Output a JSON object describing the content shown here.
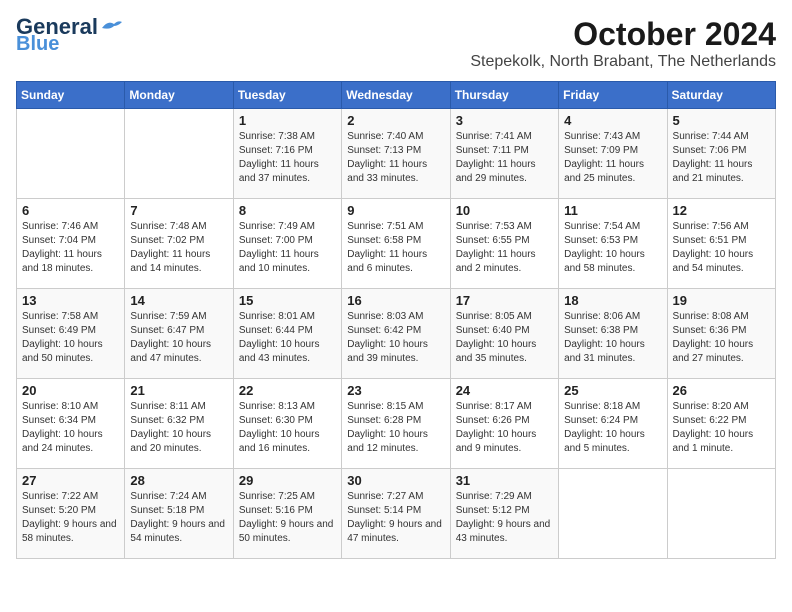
{
  "header": {
    "logo_line1": "General",
    "logo_line2": "Blue",
    "month": "October 2024",
    "location": "Stepekolk, North Brabant, The Netherlands"
  },
  "weekdays": [
    "Sunday",
    "Monday",
    "Tuesday",
    "Wednesday",
    "Thursday",
    "Friday",
    "Saturday"
  ],
  "weeks": [
    [
      {
        "day": "",
        "info": ""
      },
      {
        "day": "",
        "info": ""
      },
      {
        "day": "1",
        "info": "Sunrise: 7:38 AM\nSunset: 7:16 PM\nDaylight: 11 hours and 37 minutes."
      },
      {
        "day": "2",
        "info": "Sunrise: 7:40 AM\nSunset: 7:13 PM\nDaylight: 11 hours and 33 minutes."
      },
      {
        "day": "3",
        "info": "Sunrise: 7:41 AM\nSunset: 7:11 PM\nDaylight: 11 hours and 29 minutes."
      },
      {
        "day": "4",
        "info": "Sunrise: 7:43 AM\nSunset: 7:09 PM\nDaylight: 11 hours and 25 minutes."
      },
      {
        "day": "5",
        "info": "Sunrise: 7:44 AM\nSunset: 7:06 PM\nDaylight: 11 hours and 21 minutes."
      }
    ],
    [
      {
        "day": "6",
        "info": "Sunrise: 7:46 AM\nSunset: 7:04 PM\nDaylight: 11 hours and 18 minutes."
      },
      {
        "day": "7",
        "info": "Sunrise: 7:48 AM\nSunset: 7:02 PM\nDaylight: 11 hours and 14 minutes."
      },
      {
        "day": "8",
        "info": "Sunrise: 7:49 AM\nSunset: 7:00 PM\nDaylight: 11 hours and 10 minutes."
      },
      {
        "day": "9",
        "info": "Sunrise: 7:51 AM\nSunset: 6:58 PM\nDaylight: 11 hours and 6 minutes."
      },
      {
        "day": "10",
        "info": "Sunrise: 7:53 AM\nSunset: 6:55 PM\nDaylight: 11 hours and 2 minutes."
      },
      {
        "day": "11",
        "info": "Sunrise: 7:54 AM\nSunset: 6:53 PM\nDaylight: 10 hours and 58 minutes."
      },
      {
        "day": "12",
        "info": "Sunrise: 7:56 AM\nSunset: 6:51 PM\nDaylight: 10 hours and 54 minutes."
      }
    ],
    [
      {
        "day": "13",
        "info": "Sunrise: 7:58 AM\nSunset: 6:49 PM\nDaylight: 10 hours and 50 minutes."
      },
      {
        "day": "14",
        "info": "Sunrise: 7:59 AM\nSunset: 6:47 PM\nDaylight: 10 hours and 47 minutes."
      },
      {
        "day": "15",
        "info": "Sunrise: 8:01 AM\nSunset: 6:44 PM\nDaylight: 10 hours and 43 minutes."
      },
      {
        "day": "16",
        "info": "Sunrise: 8:03 AM\nSunset: 6:42 PM\nDaylight: 10 hours and 39 minutes."
      },
      {
        "day": "17",
        "info": "Sunrise: 8:05 AM\nSunset: 6:40 PM\nDaylight: 10 hours and 35 minutes."
      },
      {
        "day": "18",
        "info": "Sunrise: 8:06 AM\nSunset: 6:38 PM\nDaylight: 10 hours and 31 minutes."
      },
      {
        "day": "19",
        "info": "Sunrise: 8:08 AM\nSunset: 6:36 PM\nDaylight: 10 hours and 27 minutes."
      }
    ],
    [
      {
        "day": "20",
        "info": "Sunrise: 8:10 AM\nSunset: 6:34 PM\nDaylight: 10 hours and 24 minutes."
      },
      {
        "day": "21",
        "info": "Sunrise: 8:11 AM\nSunset: 6:32 PM\nDaylight: 10 hours and 20 minutes."
      },
      {
        "day": "22",
        "info": "Sunrise: 8:13 AM\nSunset: 6:30 PM\nDaylight: 10 hours and 16 minutes."
      },
      {
        "day": "23",
        "info": "Sunrise: 8:15 AM\nSunset: 6:28 PM\nDaylight: 10 hours and 12 minutes."
      },
      {
        "day": "24",
        "info": "Sunrise: 8:17 AM\nSunset: 6:26 PM\nDaylight: 10 hours and 9 minutes."
      },
      {
        "day": "25",
        "info": "Sunrise: 8:18 AM\nSunset: 6:24 PM\nDaylight: 10 hours and 5 minutes."
      },
      {
        "day": "26",
        "info": "Sunrise: 8:20 AM\nSunset: 6:22 PM\nDaylight: 10 hours and 1 minute."
      }
    ],
    [
      {
        "day": "27",
        "info": "Sunrise: 7:22 AM\nSunset: 5:20 PM\nDaylight: 9 hours and 58 minutes."
      },
      {
        "day": "28",
        "info": "Sunrise: 7:24 AM\nSunset: 5:18 PM\nDaylight: 9 hours and 54 minutes."
      },
      {
        "day": "29",
        "info": "Sunrise: 7:25 AM\nSunset: 5:16 PM\nDaylight: 9 hours and 50 minutes."
      },
      {
        "day": "30",
        "info": "Sunrise: 7:27 AM\nSunset: 5:14 PM\nDaylight: 9 hours and 47 minutes."
      },
      {
        "day": "31",
        "info": "Sunrise: 7:29 AM\nSunset: 5:12 PM\nDaylight: 9 hours and 43 minutes."
      },
      {
        "day": "",
        "info": ""
      },
      {
        "day": "",
        "info": ""
      }
    ]
  ]
}
